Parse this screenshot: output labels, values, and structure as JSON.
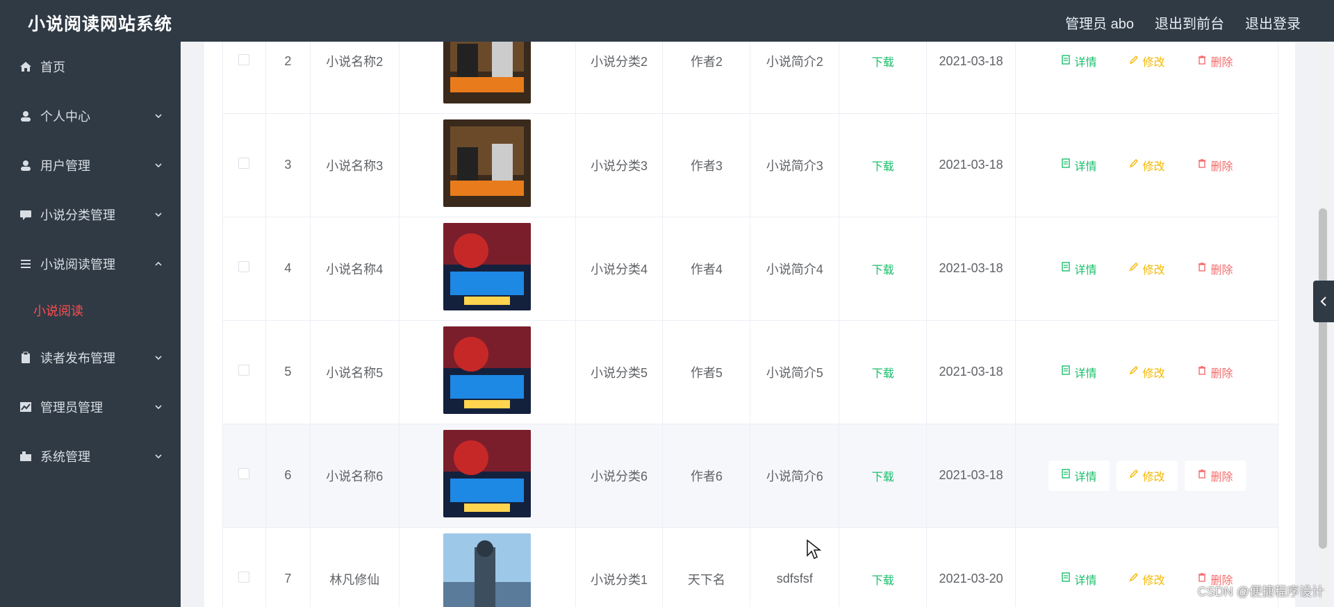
{
  "app": {
    "title": "小说阅读网站系统"
  },
  "header": {
    "admin": "管理员 abo",
    "to_front": "退出到前台",
    "logout": "退出登录"
  },
  "sidebar": {
    "items": [
      {
        "label": "首页",
        "icon": "home-icon"
      },
      {
        "label": "个人中心",
        "icon": "user-icon"
      },
      {
        "label": "用户管理",
        "icon": "user-icon"
      },
      {
        "label": "小说分类管理",
        "icon": "chat-icon"
      },
      {
        "label": "小说阅读管理",
        "icon": "list-icon",
        "expanded": true,
        "sub": "小说阅读"
      },
      {
        "label": "读者发布管理",
        "icon": "clipboard-icon"
      },
      {
        "label": "管理员管理",
        "icon": "chart-icon"
      },
      {
        "label": "系统管理",
        "icon": "settings-icon"
      }
    ]
  },
  "rows": [
    {
      "idx": "2",
      "name": "小说名称2",
      "cover": "cover-red",
      "category": "小说分类2",
      "author": "作者2",
      "desc": "小说简介2",
      "download": "下载",
      "date": "2021-03-18"
    },
    {
      "idx": "3",
      "name": "小说名称3",
      "cover": "cover-red",
      "category": "小说分类3",
      "author": "作者3",
      "desc": "小说简介3",
      "download": "下载",
      "date": "2021-03-18"
    },
    {
      "idx": "4",
      "name": "小说名称4",
      "cover": "cover-blue",
      "category": "小说分类4",
      "author": "作者4",
      "desc": "小说简介4",
      "download": "下载",
      "date": "2021-03-18"
    },
    {
      "idx": "5",
      "name": "小说名称5",
      "cover": "cover-blue",
      "category": "小说分类5",
      "author": "作者5",
      "desc": "小说简介5",
      "download": "下载",
      "date": "2021-03-18"
    },
    {
      "idx": "6",
      "name": "小说名称6",
      "cover": "cover-blue",
      "category": "小说分类6",
      "author": "作者6",
      "desc": "小说简介6",
      "download": "下载",
      "date": "2021-03-18"
    },
    {
      "idx": "7",
      "name": "林凡修仙",
      "cover": "cover-sky",
      "category": "小说分类1",
      "author": "天下名",
      "desc": "sdfsfsf",
      "download": "下载",
      "date": "2021-03-20"
    }
  ],
  "actions": {
    "detail": "详情",
    "edit": "修改",
    "delete": "删除"
  },
  "watermark": "CSDN @便捷程序设计"
}
